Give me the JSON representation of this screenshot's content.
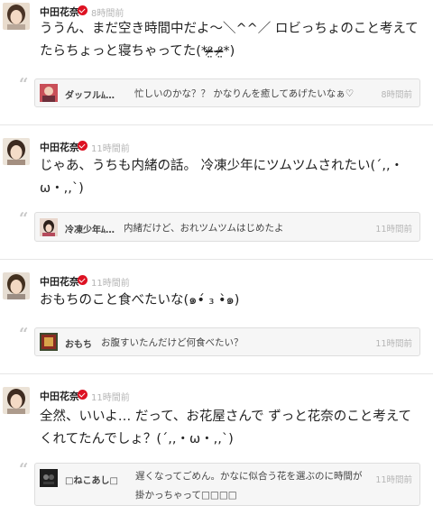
{
  "posts": [
    {
      "author": "中田花奈",
      "time": "8時間前",
      "text": "ううん、まだ空き時間中だよ〜＼^^／ ロビっちょのこと考えてたらちょっと寝ちゃってた(*ᵒ̴̶̷̤‐ᵒ̴̶̷̤*)",
      "reply": {
        "name": "ダッフルﾑ…",
        "text": "忙しいのかな？？ かなりんを癒してあげたいなぁ♡",
        "time": "8時間前"
      }
    },
    {
      "author": "中田花奈",
      "time": "11時間前",
      "text": "じゃあ、うちも内緒の話。 冷凍少年にツムツムされたい(´,,・ω・,,`)",
      "reply": {
        "name": "冷凍少年ﾑ…",
        "text": "内緒だけど、おれツムツムはじめたよ",
        "time": "11時間前"
      }
    },
    {
      "author": "中田花奈",
      "time": "11時間前",
      "text": "おもちのこと食べたいな(๑•́ ₃ •̀๑)",
      "reply": {
        "name": "おもち",
        "text": "お腹すいたんだけど何食べたい？",
        "time": "11時間前"
      }
    },
    {
      "author": "中田花奈",
      "time": "11時間前",
      "text": "全然、いいよ… だって、お花屋さんで ずっと花奈のこと考えてくれてたんでしょ？(´,,・ω・,,`)",
      "reply": {
        "name": "□ねこあし□",
        "text": "遅くなってごめん。かなに似合う花を選ぶのに時間が掛かっちゃって□□□□",
        "time": "11時間前"
      }
    }
  ],
  "colors": {
    "verified": "#dd1122",
    "muted": "#b5b5b5",
    "reply_bg": "#f6f6f6"
  },
  "icons": {
    "verified": "verified-badge-icon",
    "quote": "quote-icon"
  }
}
